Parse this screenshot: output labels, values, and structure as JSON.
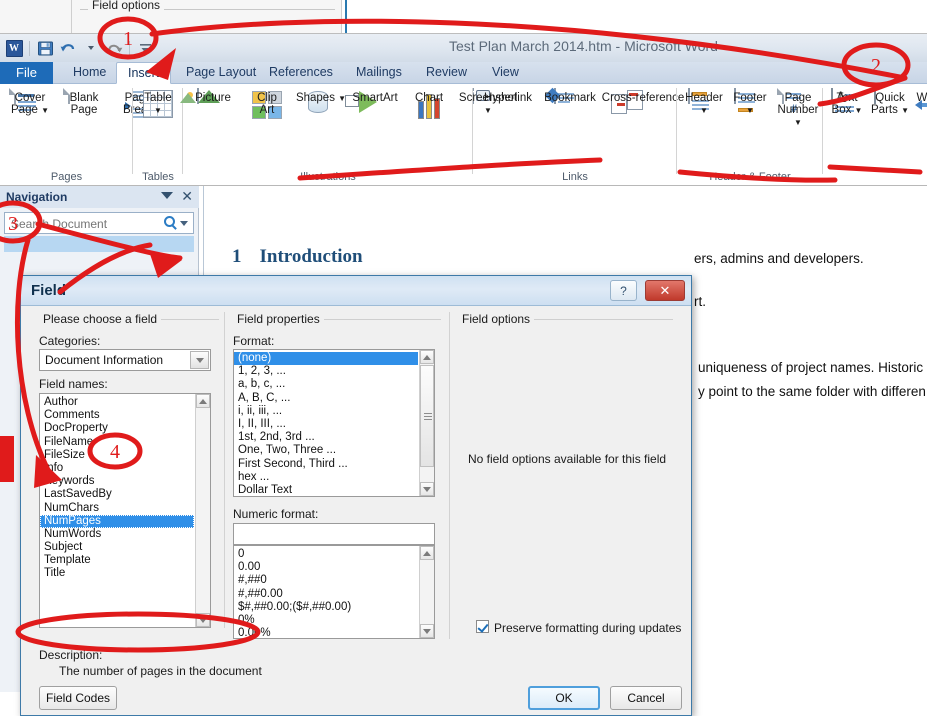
{
  "top_strip": {
    "group_caption": "Field options"
  },
  "window": {
    "title": "Test Plan March 2014.htm  -  Microsoft Word",
    "quick_access": [
      "word-logo-icon",
      "save-icon",
      "undo-icon",
      "redo-icon",
      "customize-qat-icon"
    ]
  },
  "ribbon": {
    "tabs": [
      {
        "label": "File",
        "state": "file"
      },
      {
        "label": "Home",
        "state": "normal"
      },
      {
        "label": "Insert",
        "state": "active"
      },
      {
        "label": "Page Layout",
        "state": "normal"
      },
      {
        "label": "References",
        "state": "normal"
      },
      {
        "label": "Mailings",
        "state": "normal"
      },
      {
        "label": "Review",
        "state": "normal"
      },
      {
        "label": "View",
        "state": "normal"
      }
    ],
    "groups": [
      {
        "name": "Pages",
        "items": [
          {
            "label": "Cover\nPage",
            "icon": "cover-page-icon",
            "dropdown": true
          },
          {
            "label": "Blank\nPage",
            "icon": "blank-page-icon",
            "dropdown": false
          },
          {
            "label": "Page\nBreak",
            "icon": "page-break-icon",
            "dropdown": false
          }
        ]
      },
      {
        "name": "Tables",
        "items": [
          {
            "label": "Table",
            "icon": "table-icon",
            "dropdown": true
          }
        ]
      },
      {
        "name": "Illustrations",
        "items": [
          {
            "label": "Picture",
            "icon": "picture-icon",
            "dropdown": false
          },
          {
            "label": "Clip\nArt",
            "icon": "clip-art-icon",
            "dropdown": false
          },
          {
            "label": "Shapes",
            "icon": "shapes-icon",
            "dropdown": true
          },
          {
            "label": "SmartArt",
            "icon": "smartart-icon",
            "dropdown": false
          },
          {
            "label": "Chart",
            "icon": "chart-icon",
            "dropdown": false
          },
          {
            "label": "Screenshot",
            "icon": "screenshot-icon",
            "dropdown": true
          }
        ]
      },
      {
        "name": "Links",
        "items": [
          {
            "label": "Hyperlink",
            "icon": "hyperlink-icon",
            "dropdown": false
          },
          {
            "label": "Bookmark",
            "icon": "bookmark-icon",
            "dropdown": false
          },
          {
            "label": "Cross-reference",
            "icon": "cross-reference-icon",
            "dropdown": false
          }
        ]
      },
      {
        "name": "Header & Footer",
        "items": [
          {
            "label": "Header",
            "icon": "header-icon",
            "dropdown": true
          },
          {
            "label": "Footer",
            "icon": "footer-icon",
            "dropdown": true
          },
          {
            "label": "Page\nNumber",
            "icon": "page-number-icon",
            "dropdown": true
          }
        ]
      },
      {
        "name": "",
        "items": [
          {
            "label": "Text\nBox",
            "icon": "text-box-icon",
            "dropdown": true
          },
          {
            "label": "Quick\nParts",
            "icon": "quick-parts-icon",
            "dropdown": true
          },
          {
            "label": "Wo",
            "icon": "wordart-icon",
            "dropdown": false
          }
        ]
      }
    ]
  },
  "navigation": {
    "title": "Navigation",
    "search_placeholder": "Search Document",
    "search_value": ""
  },
  "document": {
    "heading_number": "1",
    "heading_text": "Introduction",
    "lines": [
      "rt.",
      "ers, admins and developers.",
      "uniqueness of project names. Historic",
      "y point to the same folder with differen"
    ]
  },
  "dialog": {
    "title": "Field",
    "help_glyph": "?",
    "close_glyph": "✕",
    "choose_field_caption": "Please choose a field",
    "categories_label": "Categories:",
    "categories_value": "Document Information",
    "field_names_label": "Field names:",
    "field_names": [
      "Author",
      "Comments",
      "DocProperty",
      "FileName",
      "FileSize",
      "Info",
      "Keywords",
      "LastSavedBy",
      "NumChars",
      "NumPages",
      "NumWords",
      "Subject",
      "Template",
      "Title"
    ],
    "field_names_selected": "NumPages",
    "field_properties_caption": "Field properties",
    "format_label": "Format:",
    "formats": [
      "(none)",
      "1, 2, 3, ...",
      "a, b, c, ...",
      "A, B, C, ...",
      "i, ii, iii, ...",
      "I, II, III, ...",
      "1st, 2nd, 3rd ...",
      "One, Two, Three ...",
      "First Second, Third ...",
      "hex ...",
      "Dollar Text"
    ],
    "formats_selected": "(none)",
    "numeric_format_label": "Numeric format:",
    "numeric_format_value": "",
    "numeric_formats": [
      "0",
      "0.00",
      "#,##0",
      "#,##0.00",
      "$#,##0.00;($#,##0.00)",
      "0%",
      "0.00%"
    ],
    "field_options_caption": "Field options",
    "field_options_message": "No field options available for this field",
    "preserve_formatting_label": "Preserve formatting during updates",
    "preserve_formatting_checked": true,
    "description_label": "Description:",
    "description_text": "The number of pages in the document",
    "field_codes_button": "Field Codes",
    "ok_button": "OK",
    "cancel_button": "Cancel"
  },
  "annotations": {
    "color": "#e01b1b",
    "markers": [
      {
        "label": "1"
      },
      {
        "label": "2"
      },
      {
        "label": "3"
      },
      {
        "label": "4"
      }
    ]
  }
}
